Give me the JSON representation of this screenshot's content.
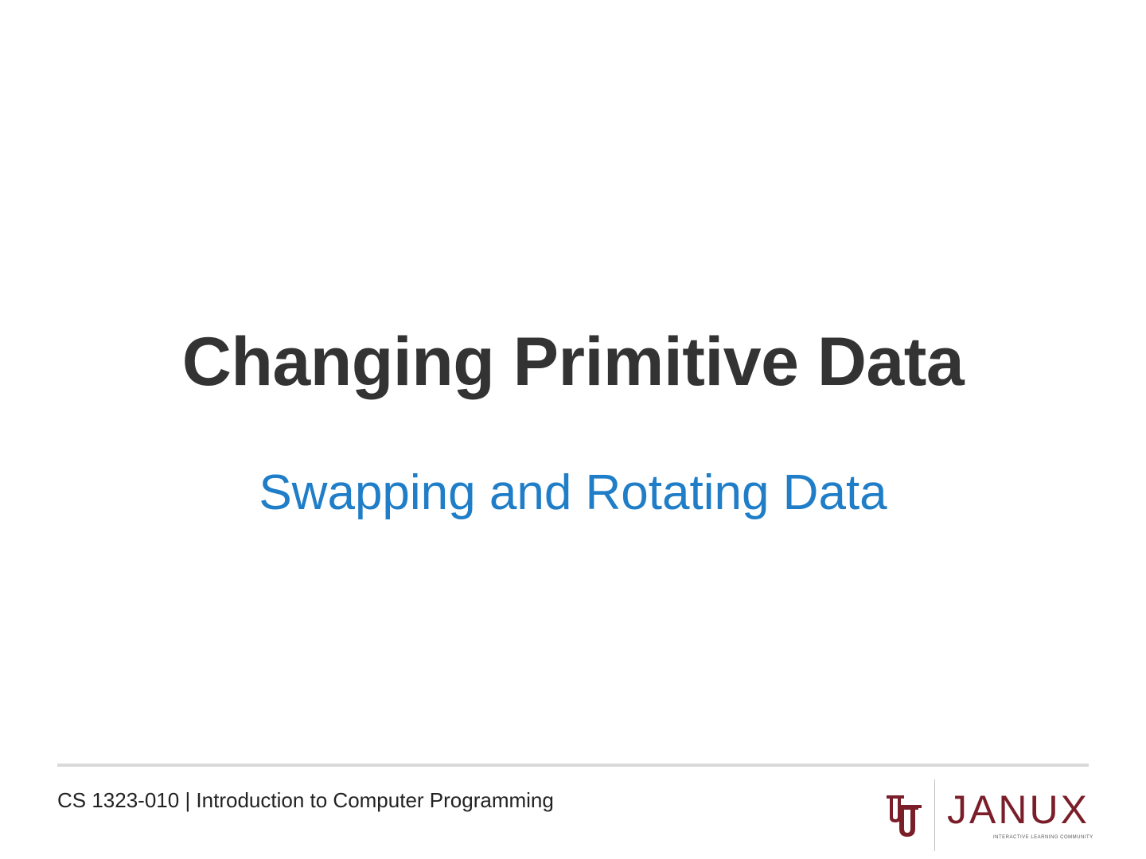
{
  "slide": {
    "title": "Changing Primitive Data",
    "subtitle": "Swapping and Rotating Data"
  },
  "footer": {
    "course": "CS 1323-010 | Introduction to Computer Programming",
    "logo": {
      "brand": "JANUX",
      "tagline": "INTERACTIVE LEARNING COMMUNITY",
      "emblem_icon": "ou-interlocking-logo-icon",
      "brand_color": "#7a1f2a"
    }
  },
  "colors": {
    "title": "#333333",
    "subtitle": "#1f7ec7",
    "rule": "#d9d9d9",
    "background": "#ffffff"
  }
}
